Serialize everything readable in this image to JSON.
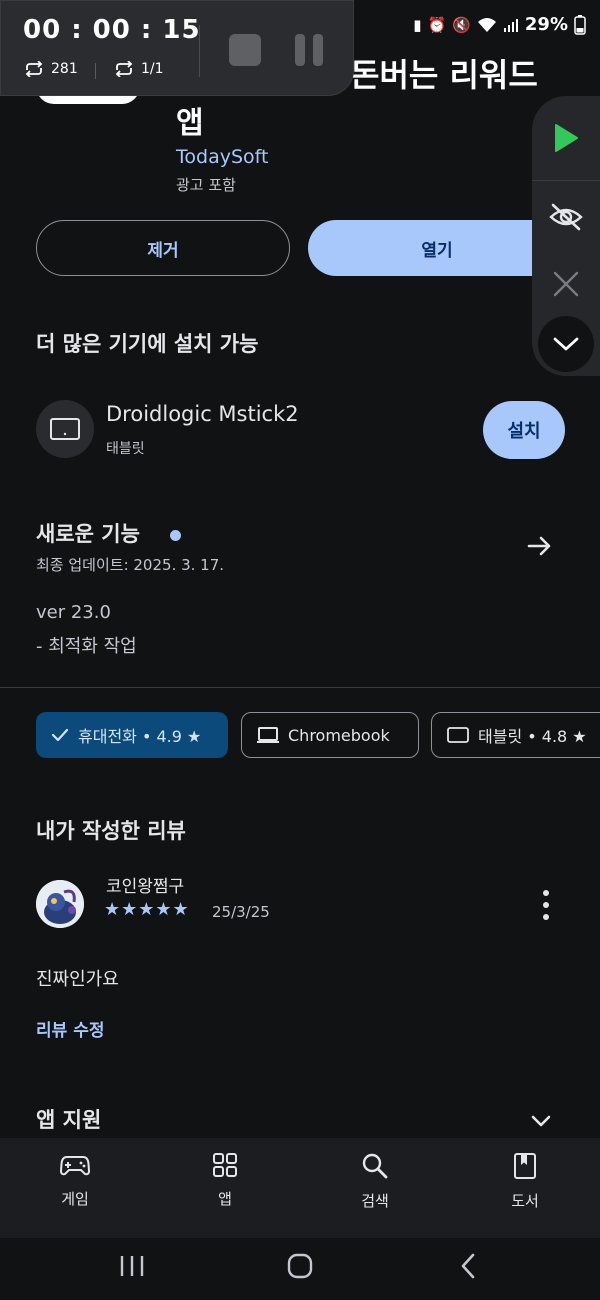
{
  "status_bar": {
    "battery": "29%"
  },
  "recorder": {
    "time": "00 : 00 :  15",
    "loop_count": "281",
    "loop_ratio": "1/1"
  },
  "app": {
    "title_line1": "돈버는 리워드",
    "title_line2": "앱",
    "developer": "TodaySoft",
    "ads_notice": "광고 포함"
  },
  "actions": {
    "remove_label": "제거",
    "open_label": "열기"
  },
  "devices_section": {
    "title": "더 많은 기기에 설치 가능",
    "device": {
      "name": "Droidlogic Mstick2",
      "type": "태블릿",
      "install_label": "설치"
    }
  },
  "whats_new": {
    "title": "새로운 기능",
    "last_update": "최종 업데이트: 2025. 3. 17.",
    "version": "ver 23.0",
    "changes": "- 최적화 작업"
  },
  "device_filters": [
    {
      "label": "휴대전화 • 4.9 ★",
      "selected": true
    },
    {
      "label": "Chromebook",
      "selected": false
    },
    {
      "label": "태블릿 • 4.8 ★",
      "selected": false
    }
  ],
  "my_review": {
    "title": "내가 작성한 리뷰",
    "reviewer": "코인왕쩜구",
    "rating": 5,
    "stars": "★★★★★",
    "date": "25/3/25",
    "text": "진짜인가요",
    "edit_label": "리뷰 수정"
  },
  "app_support": {
    "title": "앱 지원"
  },
  "bottom_nav": [
    {
      "label": "게임",
      "icon": "gamepad-icon"
    },
    {
      "label": "앱",
      "icon": "apps-grid-icon"
    },
    {
      "label": "검색",
      "icon": "search-icon"
    },
    {
      "label": "도서",
      "icon": "book-icon"
    }
  ],
  "colors": {
    "accent": "#a8c7fa",
    "background": "#111214",
    "chip_selected": "#0b4a7a",
    "play_green": "#34c759"
  }
}
